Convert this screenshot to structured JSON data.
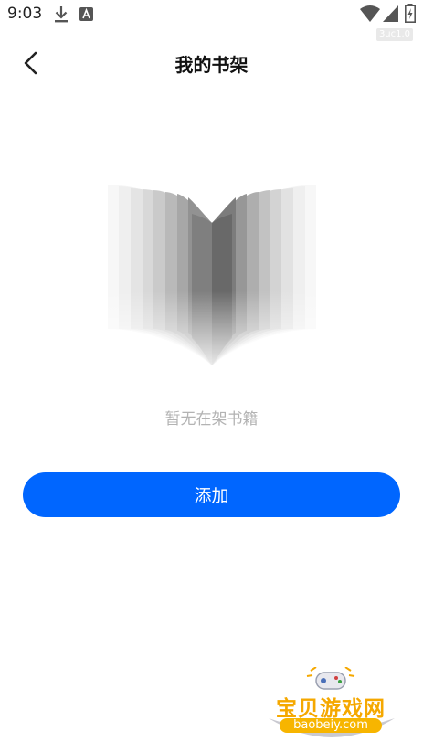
{
  "status_bar": {
    "time": "9:03",
    "icons": [
      "download-icon",
      "a-icon",
      "wifi-icon",
      "signal-icon",
      "battery-icon"
    ],
    "version_tag": "3uc1.0"
  },
  "header": {
    "title": "我的书架",
    "back_icon": "chevron-left-icon"
  },
  "empty_state": {
    "illustration": "open-book-icon",
    "message": "暂无在架书籍"
  },
  "actions": {
    "add_label": "添加"
  },
  "watermark": {
    "name": "宝贝游戏网",
    "url": "baobeiy.com"
  },
  "colors": {
    "accent": "#0066ff",
    "empty_text": "#b3b3b3",
    "watermark": "#f5a800"
  }
}
